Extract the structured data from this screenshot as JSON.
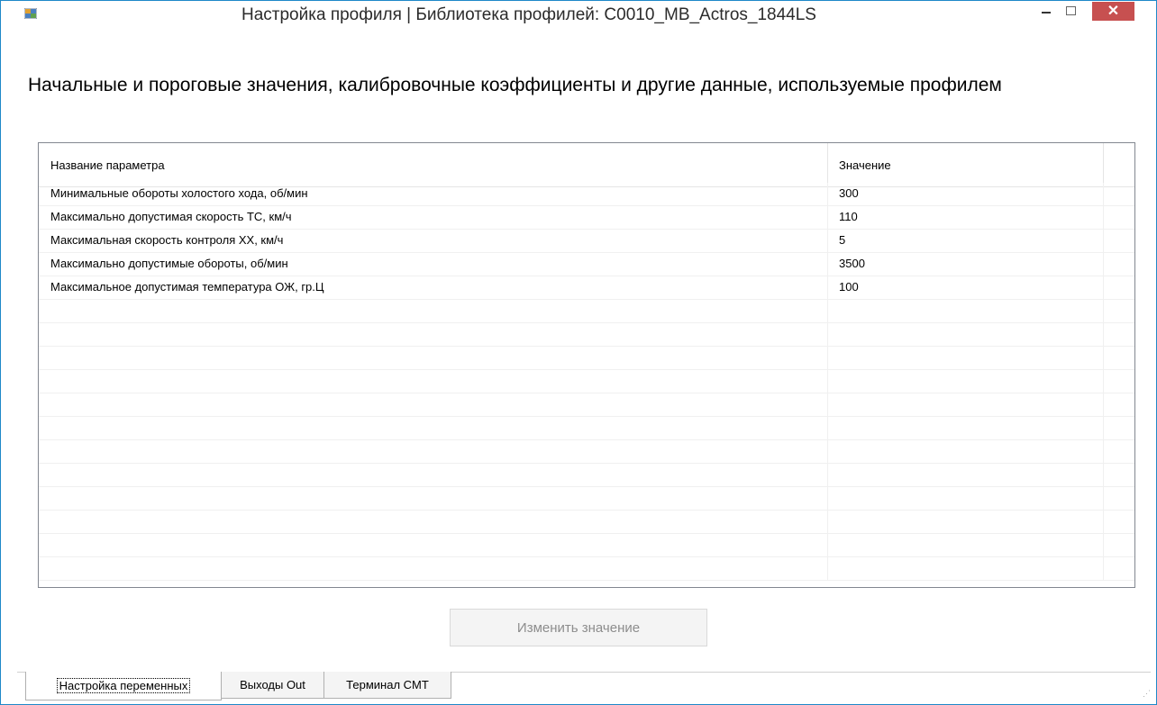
{
  "window": {
    "title": "Настройка профиля | Библиотека профилей: C0010_MB_Actros_1844LS",
    "accent": "#1e88c8",
    "close_color": "#c75050"
  },
  "heading": "Начальные и пороговые значения, калибровочные коэффициенты и другие данные, используемые профилем",
  "grid": {
    "columns": [
      "Название параметра",
      "Значение"
    ],
    "rows": [
      {
        "name": "Минимальные обороты холостого хода, об/мин",
        "value": "300"
      },
      {
        "name": "Максимально допустимая скорость ТС, км/ч",
        "value": "110"
      },
      {
        "name": "Максимальная скорость контроля ХХ, км/ч",
        "value": "5"
      },
      {
        "name": "Максимально допустимые обороты, об/мин",
        "value": "3500"
      },
      {
        "name": "Максимальное допустимая температура ОЖ, гр.Ц",
        "value": "100"
      }
    ],
    "empty_rows": 12
  },
  "change_button": "Изменить значение",
  "tabs": [
    {
      "label": "Настройка переменных",
      "active": true
    },
    {
      "label": "Выходы Out",
      "active": false
    },
    {
      "label": "Терминал CMT",
      "active": false
    }
  ],
  "icons": {
    "app": "app-icon",
    "minimize": "minimize-icon",
    "maximize": "maximize-icon",
    "close": "close-icon"
  }
}
